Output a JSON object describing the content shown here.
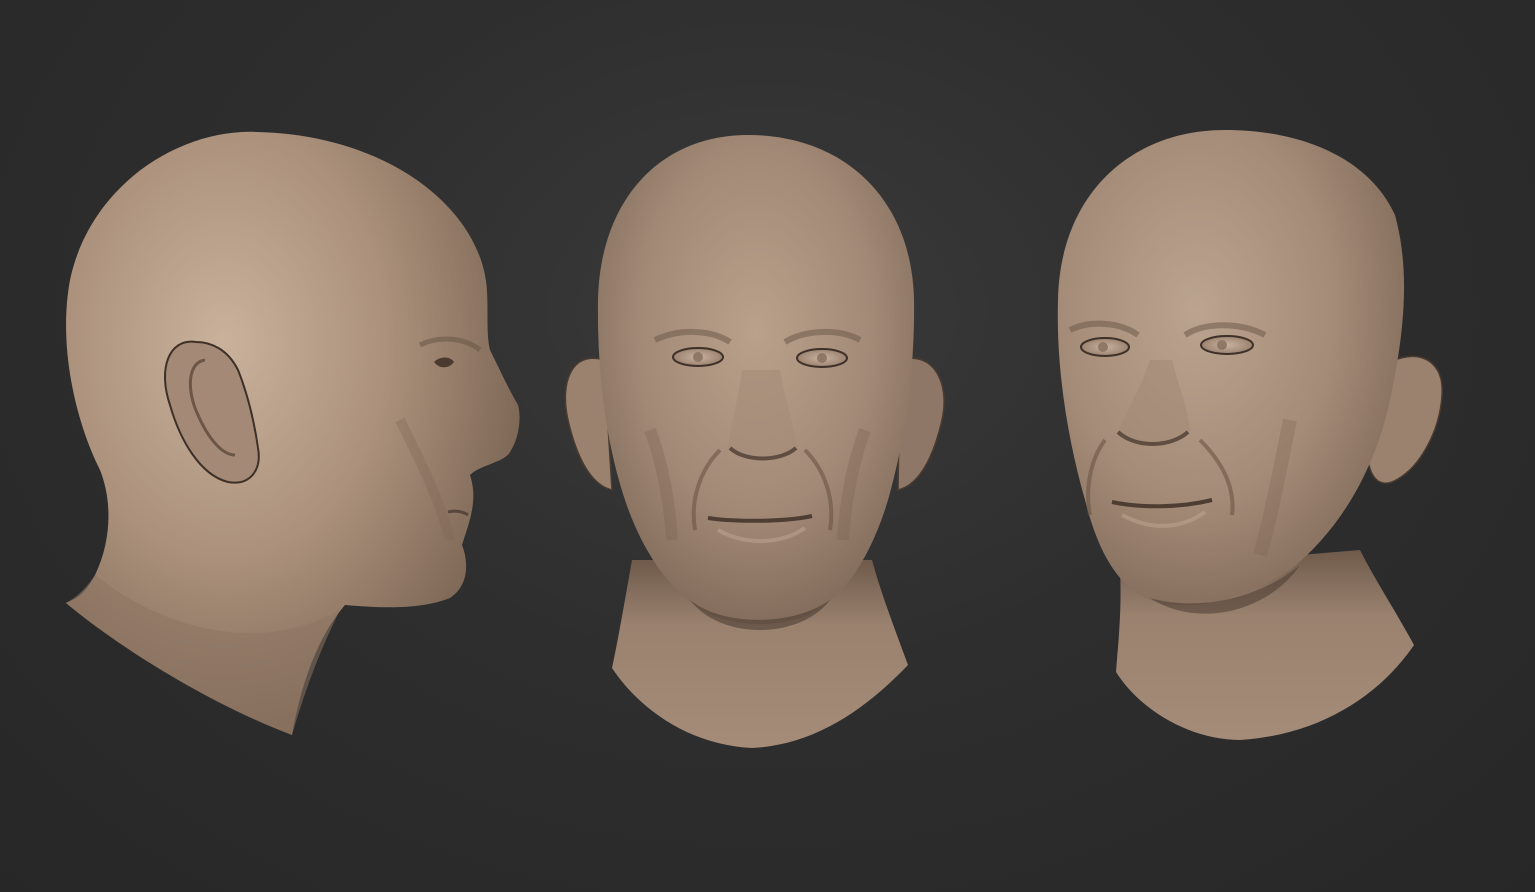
{
  "scene": {
    "description_visible": false,
    "background_color": "#2d2d2d",
    "material_color": "#a8917e",
    "views": [
      {
        "name": "side-profile",
        "facing": "right"
      },
      {
        "name": "front",
        "facing": "front"
      },
      {
        "name": "three-quarter",
        "facing": "left"
      }
    ]
  }
}
